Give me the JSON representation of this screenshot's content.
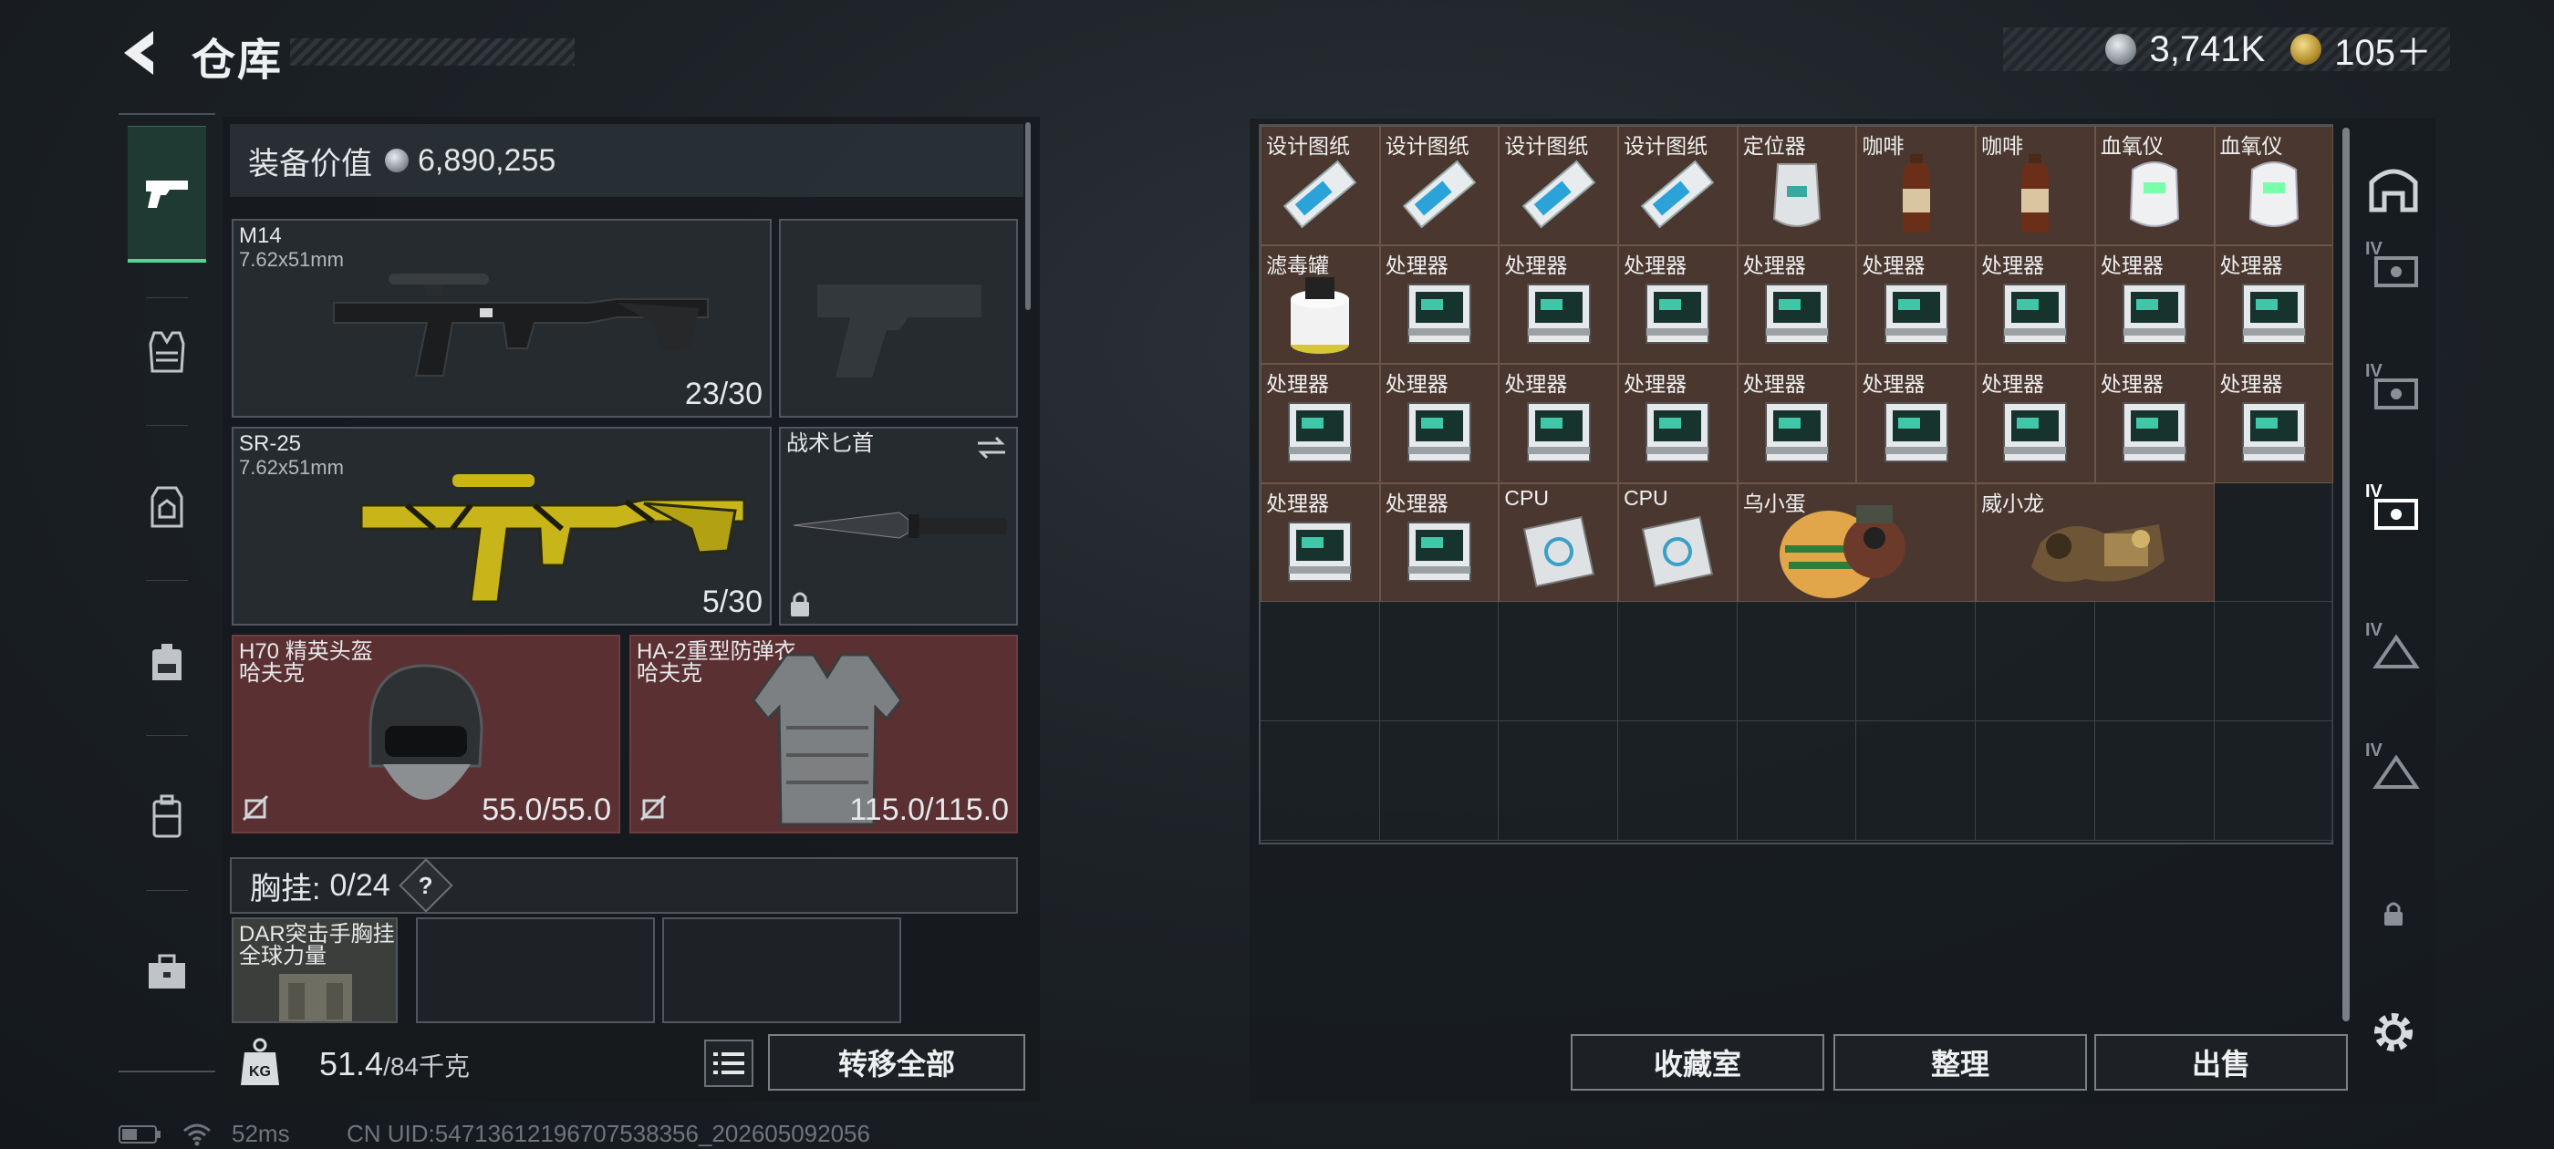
{
  "header": {
    "title": "仓库",
    "currencies": [
      {
        "icon": "silver-coin-icon",
        "value": "3,741K"
      },
      {
        "icon": "gold-coin-icon",
        "value": "105＋"
      }
    ]
  },
  "sidebar_left": {
    "tabs": [
      "weapons",
      "armor-vest",
      "chest-rig",
      "backpack",
      "case",
      "toolbox"
    ],
    "active": "weapons"
  },
  "equipment": {
    "value_label": "装备价值",
    "value": "6,890,255",
    "primary_weapon": {
      "name": "M14",
      "caliber": "7.62x51mm",
      "ammo": "23/30"
    },
    "secondary_weapon": {
      "name": "SR-25",
      "caliber": "7.62x51mm",
      "ammo": "5/30"
    },
    "melee": {
      "name": "战术匕首"
    },
    "helmet": {
      "name": "H70 精英头盔",
      "brand": "哈夫克",
      "durability": "55.0/55.0"
    },
    "armor": {
      "name": "HA-2重型防弹衣",
      "brand": "哈夫克",
      "durability": "115.0/115.0"
    },
    "rig": {
      "label": "胸挂:",
      "used": "0",
      "capacity": "/24",
      "help": "?"
    },
    "rig_item": {
      "name": "DAR突击手胸挂",
      "brand": "全球力量"
    },
    "weight": {
      "current": "51.4",
      "max": "/84千克"
    },
    "transfer_all": "转移全部"
  },
  "status": {
    "ping": "52ms",
    "uid": "CN UID:54713612196707538356_202605092056"
  },
  "storage": {
    "items": [
      {
        "label": "设计图纸",
        "icon": "blueprint-icon",
        "row": 1,
        "col": 1,
        "w": 1
      },
      {
        "label": "设计图纸",
        "icon": "blueprint-icon",
        "row": 1,
        "col": 2,
        "w": 1
      },
      {
        "label": "设计图纸",
        "icon": "blueprint-icon",
        "row": 1,
        "col": 3,
        "w": 1
      },
      {
        "label": "设计图纸",
        "icon": "blueprint-icon",
        "row": 1,
        "col": 4,
        "w": 1
      },
      {
        "label": "定位器",
        "icon": "locator-icon",
        "row": 1,
        "col": 5,
        "w": 1
      },
      {
        "label": "咖啡",
        "icon": "coffee-bottle-icon",
        "row": 1,
        "col": 6,
        "w": 1
      },
      {
        "label": "咖啡",
        "icon": "coffee-bottle-icon",
        "row": 1,
        "col": 7,
        "w": 1
      },
      {
        "label": "血氧仪",
        "icon": "oximeter-icon",
        "row": 1,
        "col": 8,
        "w": 1
      },
      {
        "label": "血氧仪",
        "icon": "oximeter-icon",
        "row": 1,
        "col": 9,
        "w": 1
      },
      {
        "label": "滤毒罐",
        "icon": "filter-canister-icon",
        "row": 2,
        "col": 1,
        "w": 1
      },
      {
        "label": "处理器",
        "icon": "processor-icon",
        "row": 2,
        "col": 2,
        "w": 1
      },
      {
        "label": "处理器",
        "icon": "processor-icon",
        "row": 2,
        "col": 3,
        "w": 1
      },
      {
        "label": "处理器",
        "icon": "processor-icon",
        "row": 2,
        "col": 4,
        "w": 1
      },
      {
        "label": "处理器",
        "icon": "processor-icon",
        "row": 2,
        "col": 5,
        "w": 1
      },
      {
        "label": "处理器",
        "icon": "processor-icon",
        "row": 2,
        "col": 6,
        "w": 1
      },
      {
        "label": "处理器",
        "icon": "processor-icon",
        "row": 2,
        "col": 7,
        "w": 1
      },
      {
        "label": "处理器",
        "icon": "processor-icon",
        "row": 2,
        "col": 8,
        "w": 1
      },
      {
        "label": "处理器",
        "icon": "processor-icon",
        "row": 2,
        "col": 9,
        "w": 1
      },
      {
        "label": "处理器",
        "icon": "processor-icon",
        "row": 3,
        "col": 1,
        "w": 1
      },
      {
        "label": "处理器",
        "icon": "processor-icon",
        "row": 3,
        "col": 2,
        "w": 1
      },
      {
        "label": "处理器",
        "icon": "processor-icon",
        "row": 3,
        "col": 3,
        "w": 1
      },
      {
        "label": "处理器",
        "icon": "processor-icon",
        "row": 3,
        "col": 4,
        "w": 1
      },
      {
        "label": "处理器",
        "icon": "processor-icon",
        "row": 3,
        "col": 5,
        "w": 1
      },
      {
        "label": "处理器",
        "icon": "processor-icon",
        "row": 3,
        "col": 6,
        "w": 1
      },
      {
        "label": "处理器",
        "icon": "processor-icon",
        "row": 3,
        "col": 7,
        "w": 1
      },
      {
        "label": "处理器",
        "icon": "processor-icon",
        "row": 3,
        "col": 8,
        "w": 1
      },
      {
        "label": "处理器",
        "icon": "processor-icon",
        "row": 3,
        "col": 9,
        "w": 1
      },
      {
        "label": "处理器",
        "icon": "processor-icon",
        "row": 4,
        "col": 1,
        "w": 1
      },
      {
        "label": "处理器",
        "icon": "processor-icon",
        "row": 4,
        "col": 2,
        "w": 1
      },
      {
        "label": "CPU",
        "icon": "cpu-chip-icon",
        "row": 4,
        "col": 3,
        "w": 1
      },
      {
        "label": "CPU",
        "icon": "cpu-chip-icon",
        "row": 4,
        "col": 4,
        "w": 1
      },
      {
        "label": "乌小蛋",
        "icon": "egg-figure-icon",
        "row": 4,
        "col": 5,
        "w": 2
      },
      {
        "label": "威小龙",
        "icon": "dragon-figure-icon",
        "row": 4,
        "col": 7,
        "w": 2
      }
    ],
    "buttons": {
      "collection": "收藏室",
      "organize": "整理",
      "sell": "出售"
    }
  },
  "sidebar_right": {
    "icons": [
      "safe-house-icon",
      "case-tier4-icon",
      "case-tier4-icon",
      "case-tier4-icon",
      "case-tier4-icon",
      "case-tier4-icon",
      "lock-icon",
      "settings-icon"
    ],
    "tier_label": "IV"
  },
  "colors": {
    "accent": "#55d49a",
    "item_bg": "#4a3830",
    "armor_slot": "#5b3032",
    "panel": "#1d2125"
  }
}
